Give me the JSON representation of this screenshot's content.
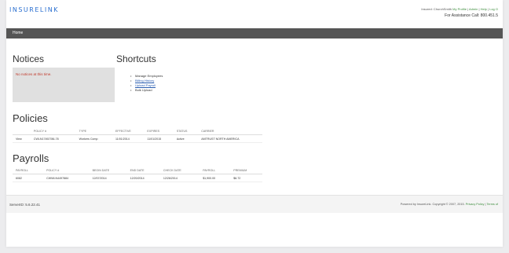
{
  "header": {
    "logo": "INSURELINK",
    "welcome": "Insured: ChurchSmith",
    "links": [
      "My Profile",
      "Admin",
      "Help",
      "Log O"
    ],
    "assistance": "For Assistance Call: 800.451.5"
  },
  "nav": {
    "home": "Home"
  },
  "notices": {
    "title": "Notices",
    "message": "No notices at this time."
  },
  "shortcuts": {
    "title": "Shortcuts",
    "items": [
      {
        "label": "Manage Employees",
        "link": false
      },
      {
        "label": "Billing History",
        "link": true
      },
      {
        "label": "Upload Payroll",
        "link": true
      },
      {
        "label": "Bulk Upload",
        "link": false
      }
    ]
  },
  "policies": {
    "title": "Policies",
    "columns": [
      "",
      "POLICY #",
      "TYPE",
      "EFFECTIVE",
      "EXPIRES",
      "STATUS",
      "CARRIER"
    ],
    "rows": [
      [
        "View",
        "CWLN17492786-78",
        "Workers Comp",
        "11/01/2014",
        "11/01/2015",
        "Active",
        "AMTRUST NORTH AMERICA"
      ]
    ]
  },
  "payrolls": {
    "title": "Payrolls",
    "columns": [
      "PAYROLL",
      "POLICY #",
      "BEGIN DATE",
      "END DATE",
      "CHECK DATE",
      "PAYROLL",
      "PREMIUM"
    ],
    "rows": [
      [
        "6082",
        "CWWLN4497884",
        "12/07/2014",
        "12/20/2014",
        "12/26/2014",
        "$1,900.00",
        "$6.72"
      ]
    ]
  },
  "footer": {
    "version": "ServerID:  5.6.22.41",
    "copyright": "Powered by InsureLink. Copyright © 2007, 2015.",
    "links": [
      "Privacy Policy",
      "Terms of"
    ]
  }
}
